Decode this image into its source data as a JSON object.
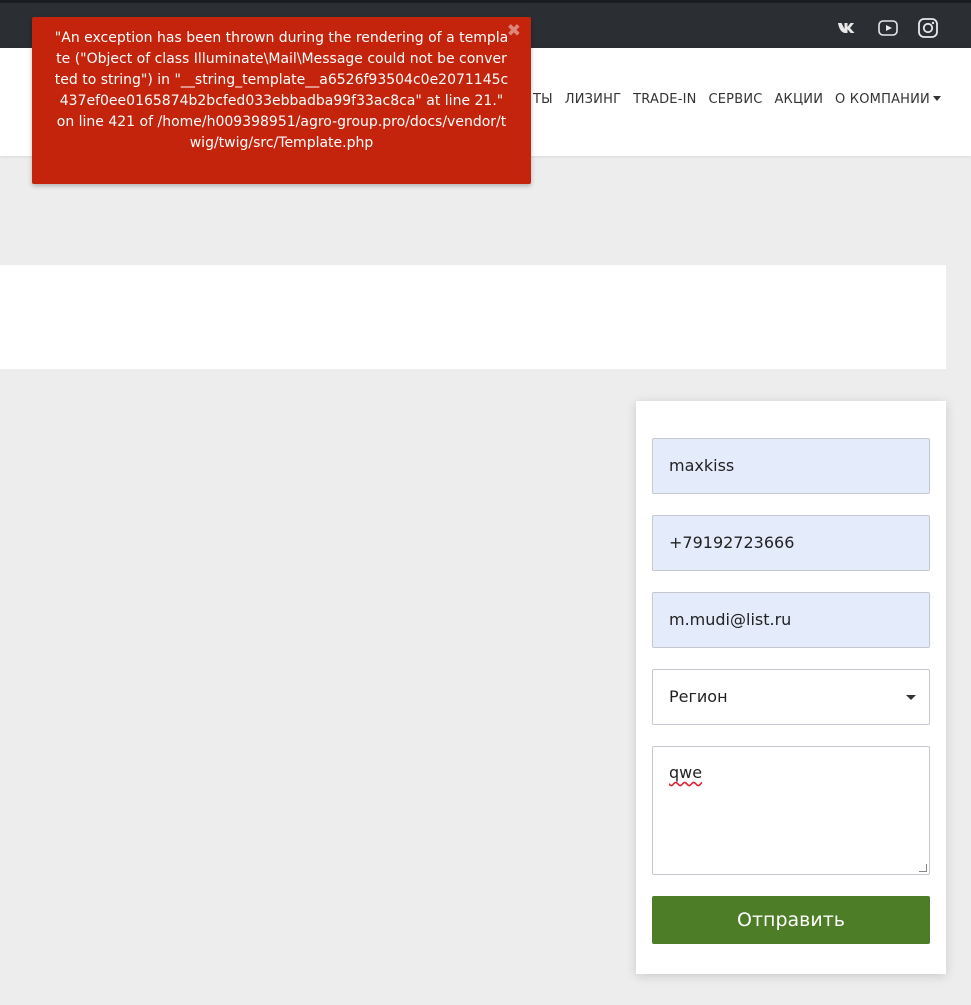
{
  "topbar": {
    "social_icons": [
      "vk-icon",
      "youtube-icon",
      "instagram-icon"
    ]
  },
  "nav": {
    "items": [
      "ТЫ",
      "ЛИЗИНГ",
      "TRADE-IN",
      "СЕРВИС",
      "АКЦИИ",
      "О КОМПАНИИ"
    ]
  },
  "error": {
    "message": "\"An exception has been thrown during the rendering of a template (\"Object of class Illuminate\\Mail\\Message could not be converted to string\") in \"__string_template__a6526f93504c0e2071145c437ef0ee0165874b2bcfed033ebbadba99f33ac8ca\" at line 21.\" on line 421 of /home/h009398951/agro-group.pro/docs/vendor/twig/twig/src/Template.php",
    "close_symbol": "✖"
  },
  "form": {
    "name_value": "maxkiss",
    "phone_value": "+79192723666",
    "email_value": "m.mudi@list.ru",
    "region_value": "Регион",
    "message_value": "qwe",
    "submit_label": "Отправить"
  },
  "colors": {
    "error_bg": "#c4240c",
    "submit_bg": "#4e7d28",
    "autofill_bg": "#e4ecfb",
    "topbar_bg": "#2b2e33"
  }
}
